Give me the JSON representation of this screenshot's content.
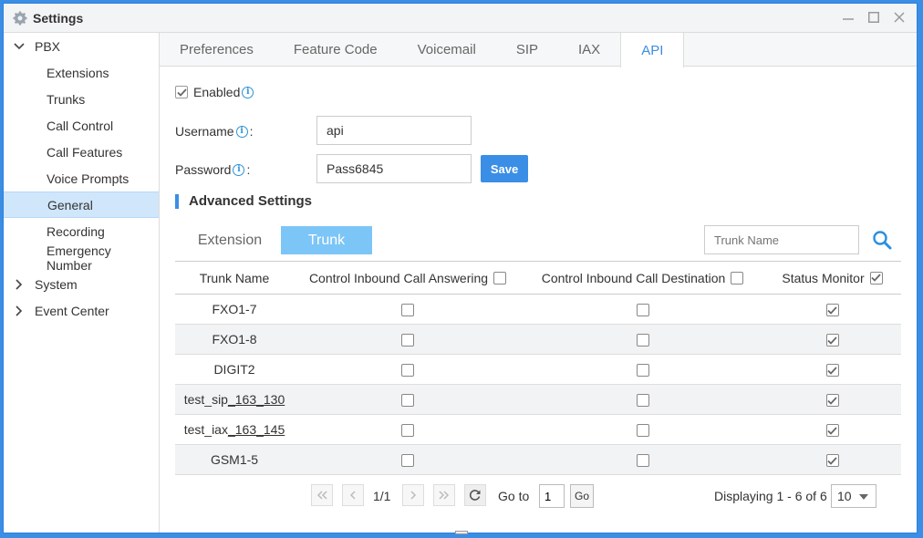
{
  "window": {
    "title": "Settings"
  },
  "sidebar": {
    "pbx_label": "PBX",
    "pbx_items": [
      {
        "label": "Extensions"
      },
      {
        "label": "Trunks"
      },
      {
        "label": "Call Control"
      },
      {
        "label": "Call Features"
      },
      {
        "label": "Voice Prompts"
      },
      {
        "label": "General"
      },
      {
        "label": "Recording"
      },
      {
        "label": "Emergency Number"
      }
    ],
    "system_label": "System",
    "event_center_label": "Event Center"
  },
  "tabs": [
    "Preferences",
    "Feature Code",
    "Voicemail",
    "SIP",
    "IAX",
    "API"
  ],
  "form": {
    "enabled_label": "Enabled",
    "enabled_checked": true,
    "username_label": "Username",
    "username_value": "api",
    "password_label": "Password",
    "password_value": "Pass6845",
    "colon": ":",
    "save_label": "Save",
    "info_glyph": "i"
  },
  "advanced": {
    "title": "Advanced Settings",
    "subtabs": [
      "Extension",
      "Trunk"
    ],
    "search_placeholder": "Trunk Name"
  },
  "table": {
    "columns": [
      "Trunk Name",
      "Control Inbound Call Answering",
      "Control Inbound Call Destination",
      "Status Monitor"
    ],
    "rows": [
      {
        "name": "FXO1-7",
        "answering": false,
        "destination": false,
        "monitor": true
      },
      {
        "name": "FXO1-8",
        "answering": false,
        "destination": false,
        "monitor": true
      },
      {
        "name": "DIGIT2",
        "answering": false,
        "destination": false,
        "monitor": true
      },
      {
        "name_prefix": "test_sip",
        "name_suffix": "_163_130",
        "answering": false,
        "destination": false,
        "monitor": true
      },
      {
        "name_prefix": "test_iax",
        "name_suffix": "_163_145",
        "answering": false,
        "destination": false,
        "monitor": true
      },
      {
        "name": "GSM1-5",
        "answering": false,
        "destination": false,
        "monitor": true
      }
    ]
  },
  "pager": {
    "page_indicator": "1/1",
    "goto_label": "Go to",
    "goto_value": "1",
    "go_label": "Go",
    "display_text": "Displaying 1 - 6 of 6",
    "page_size": "10"
  },
  "colors": {
    "accent": "#3a8ee6",
    "active_subtab": "#7cc5f7",
    "sidebar_active": "#d0e6fb"
  }
}
